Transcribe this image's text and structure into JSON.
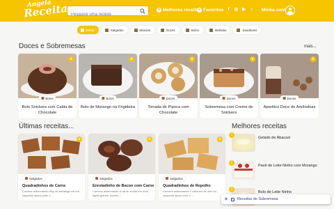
{
  "header": {
    "logo_line1": "Angela",
    "logo_line2": "Receita",
    "search_placeholder": "Pesquise uma receita",
    "nav_best": "Melhores receitas",
    "nav_favorites": "Favoritos",
    "social": [
      "f",
      "◎",
      "▶",
      "♪"
    ],
    "account": "Minha conta",
    "brand_color": "#f7c400"
  },
  "categories": [
    {
      "label": "Início",
      "icon": "home-icon",
      "active": true
    },
    {
      "label": "Salgados",
      "icon": "savory-icon"
    },
    {
      "label": "Massas",
      "icon": "pasta-icon"
    },
    {
      "label": "Doces",
      "icon": "sweets-icon"
    },
    {
      "label": "Bolos",
      "icon": "cake-icon"
    },
    {
      "label": "Bebidas",
      "icon": "drink-icon"
    },
    {
      "label": "Saudáveis",
      "icon": "healthy-icon"
    }
  ],
  "sweets": {
    "heading": "Doces e Sobremesas",
    "more": "mais...",
    "cards": [
      {
        "badge": "Bolos",
        "title": "Bolo Snickers com Calda de Chocolate"
      },
      {
        "badge": "Bolos",
        "title": "Bolo de Morango na Frigideira"
      },
      {
        "badge": "Doces",
        "title": "Torrada de Pipoca com Chocolate"
      },
      {
        "badge": "Doces",
        "title": "Sobremesa com Creme de Snickers"
      },
      {
        "badge": "Doces",
        "title": "Aperitivo Doce de Amêndoas"
      }
    ]
  },
  "latest": {
    "heading": "Últimas receitas...",
    "cards": [
      {
        "badge": "Salgados",
        "title": "Quadradinhos de Carne",
        "desc": "Comece adicionando 50g de manteiga em um saquinho ziploc junto c..."
      },
      {
        "badge": "Salgados",
        "title": "Enroladinho de Bacon com Carne",
        "desc": "Comece adicionando a carne moída em uma tigela grande. Acresc..."
      },
      {
        "badge": "Salgados",
        "title": "Quadradinhos de Repolho",
        "desc": "Comece adicionando 2 colheres de óleo no saquinho ziploc com o ..."
      }
    ]
  },
  "best": {
    "heading": "Melhores receitas",
    "items": [
      {
        "rank": "1",
        "title": "Gelado de Abacaxi"
      },
      {
        "rank": "2",
        "title": "Pavê de Leite Ninho com Morango"
      },
      {
        "rank": "3",
        "title": "Bolo de Leite Ninho"
      }
    ]
  },
  "toast": {
    "close": "✕",
    "label": "Receitas de Sobremesa"
  }
}
